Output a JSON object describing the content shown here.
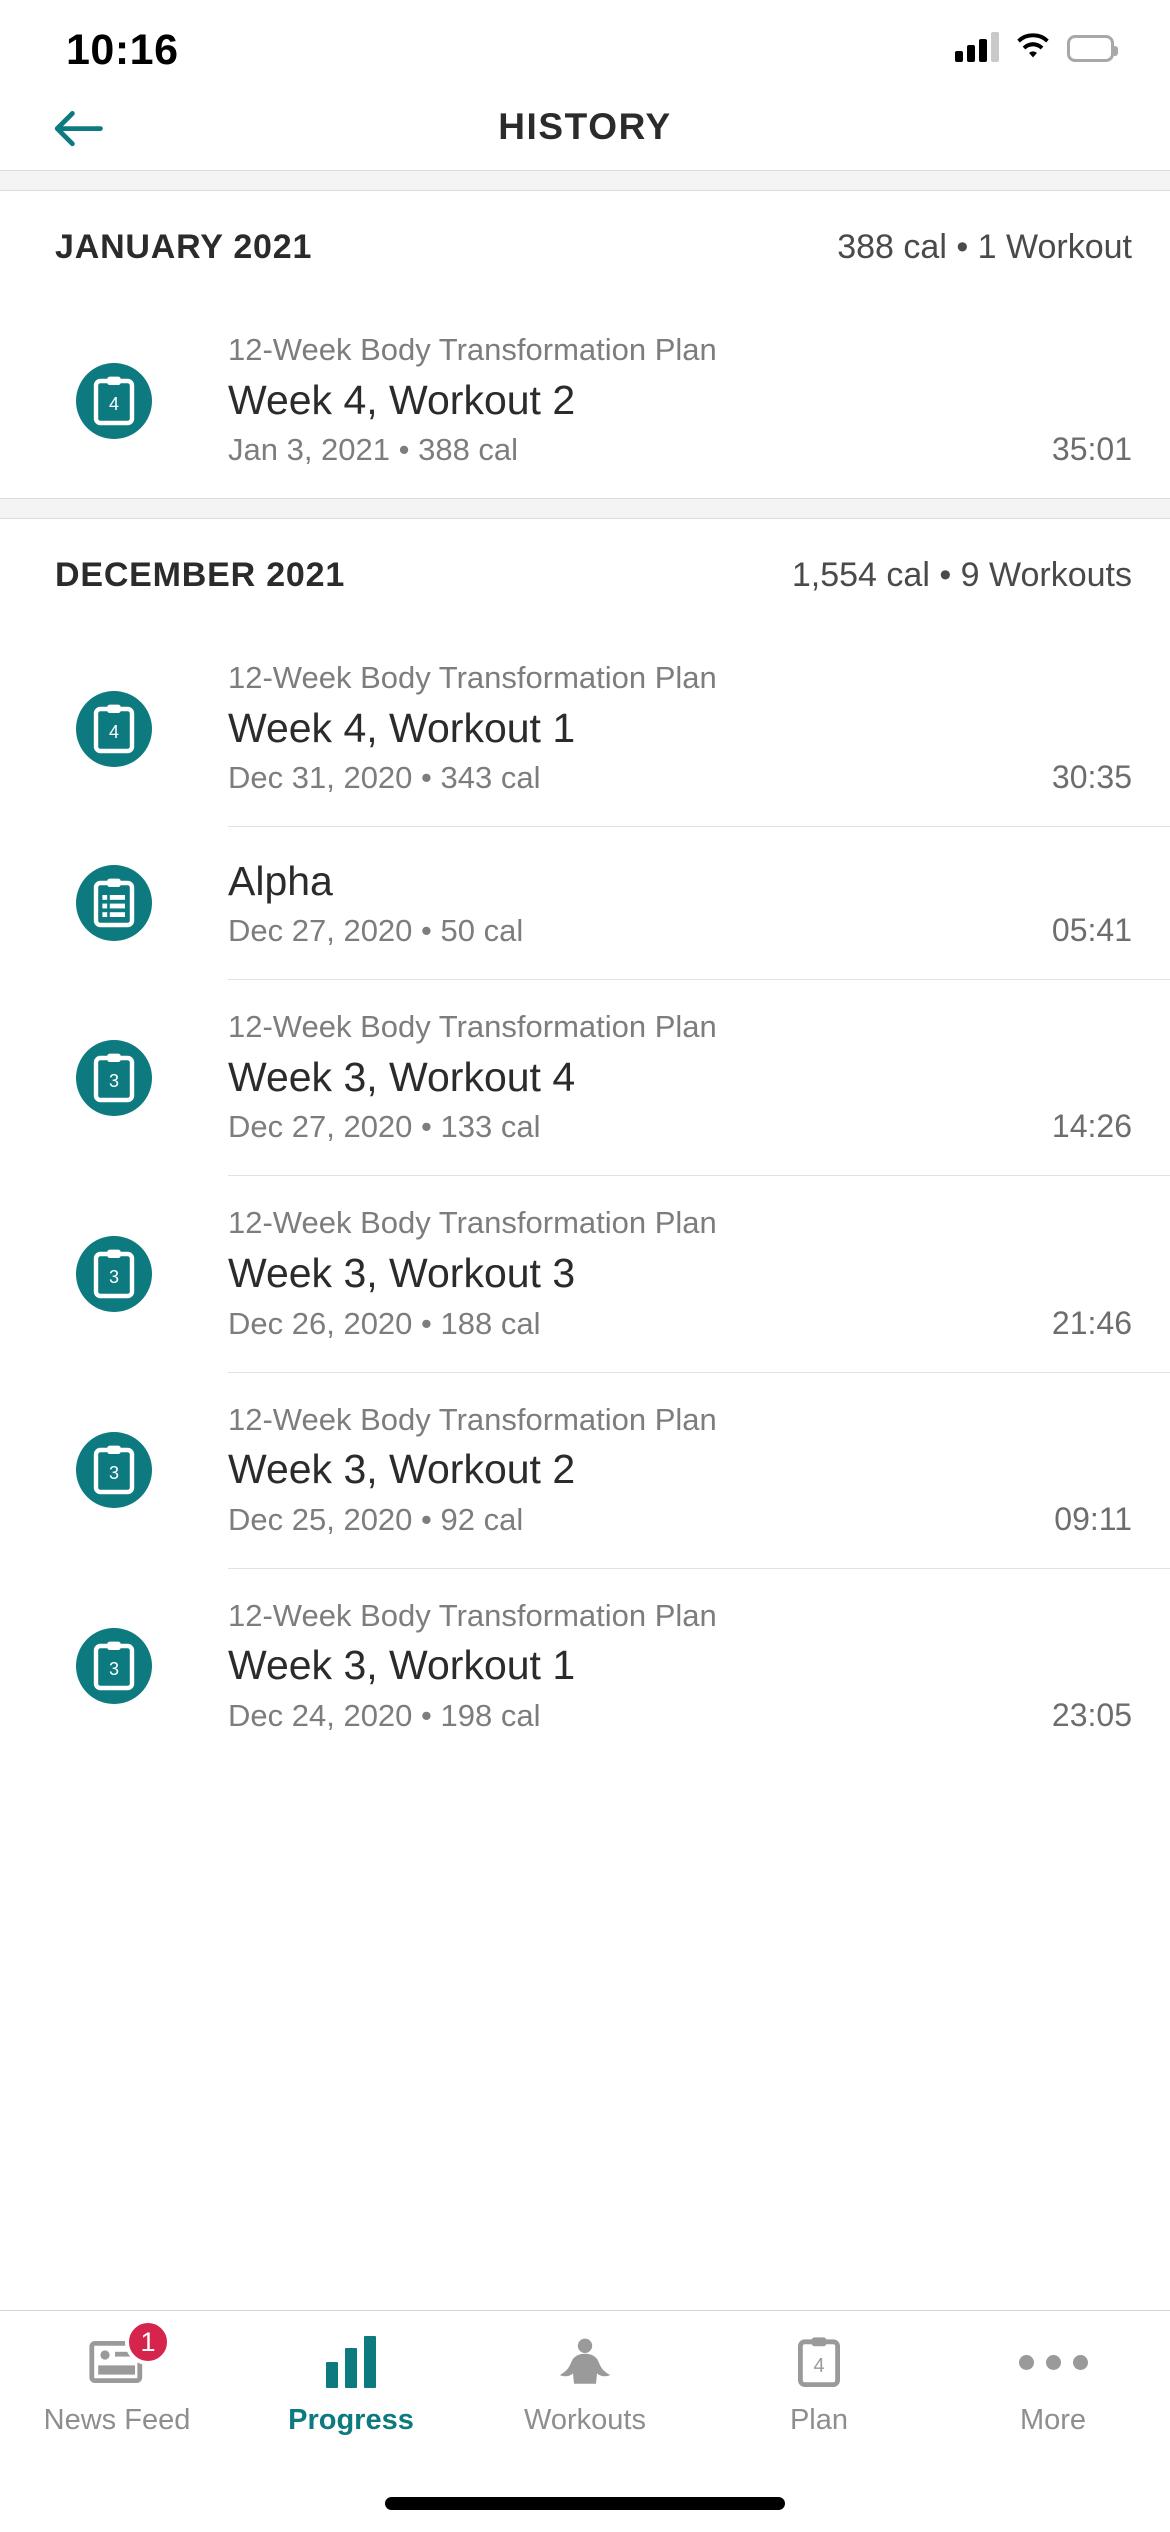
{
  "status_bar": {
    "time": "10:16",
    "cellular_icon": "cellular-bars-icon",
    "wifi_icon": "wifi-icon",
    "battery_icon": "battery-icon"
  },
  "header": {
    "title": "HISTORY",
    "back_icon": "back-arrow-icon"
  },
  "theme": {
    "accent": "#0d7a80",
    "badge": "#d6254c",
    "text_primary": "#2b2b2b",
    "text_secondary": "#7d7d7d"
  },
  "sections": [
    {
      "title": "JANUARY 2021",
      "summary": "388 cal • 1 Workout",
      "rows": [
        {
          "icon": "clipboard-week-icon",
          "icon_badge": "4",
          "plan": "12-Week Body Transformation Plan",
          "title": "Week 4, Workout 2",
          "date_cal": "Jan 3, 2021 • 388 cal",
          "duration": "35:01"
        }
      ]
    },
    {
      "title": "DECEMBER 2021",
      "summary": "1,554 cal • 9 Workouts",
      "rows": [
        {
          "icon": "clipboard-week-icon",
          "icon_badge": "4",
          "plan": "12-Week Body Transformation Plan",
          "title": "Week 4, Workout 1",
          "date_cal": "Dec 31, 2020 • 343 cal",
          "duration": "30:35"
        },
        {
          "icon": "clipboard-list-icon",
          "icon_badge": "",
          "plan": "",
          "title": "Alpha",
          "date_cal": "Dec 27, 2020 • 50 cal",
          "duration": "05:41"
        },
        {
          "icon": "clipboard-week-icon",
          "icon_badge": "3",
          "plan": "12-Week Body Transformation Plan",
          "title": "Week 3, Workout 4",
          "date_cal": "Dec 27, 2020 • 133 cal",
          "duration": "14:26"
        },
        {
          "icon": "clipboard-week-icon",
          "icon_badge": "3",
          "plan": "12-Week Body Transformation Plan",
          "title": "Week 3, Workout 3",
          "date_cal": "Dec 26, 2020 • 188 cal",
          "duration": "21:46"
        },
        {
          "icon": "clipboard-week-icon",
          "icon_badge": "3",
          "plan": "12-Week Body Transformation Plan",
          "title": "Week 3, Workout 2",
          "date_cal": "Dec 25, 2020 • 92 cal",
          "duration": "09:11"
        },
        {
          "icon": "clipboard-week-icon",
          "icon_badge": "3",
          "plan": "12-Week Body Transformation Plan",
          "title": "Week 3, Workout 1",
          "date_cal": "Dec 24, 2020 • 198 cal",
          "duration": "23:05"
        }
      ]
    }
  ],
  "tab_bar": {
    "items": [
      {
        "label": "News Feed",
        "icon": "news-feed-icon",
        "badge": "1",
        "active": false
      },
      {
        "label": "Progress",
        "icon": "bar-chart-icon",
        "badge": "",
        "active": true
      },
      {
        "label": "Workouts",
        "icon": "torso-icon",
        "badge": "",
        "active": false
      },
      {
        "label": "Plan",
        "icon": "clipboard-plan-icon",
        "badge": "",
        "plan_number": "4",
        "active": false
      },
      {
        "label": "More",
        "icon": "ellipsis-icon",
        "badge": "",
        "active": false
      }
    ]
  }
}
